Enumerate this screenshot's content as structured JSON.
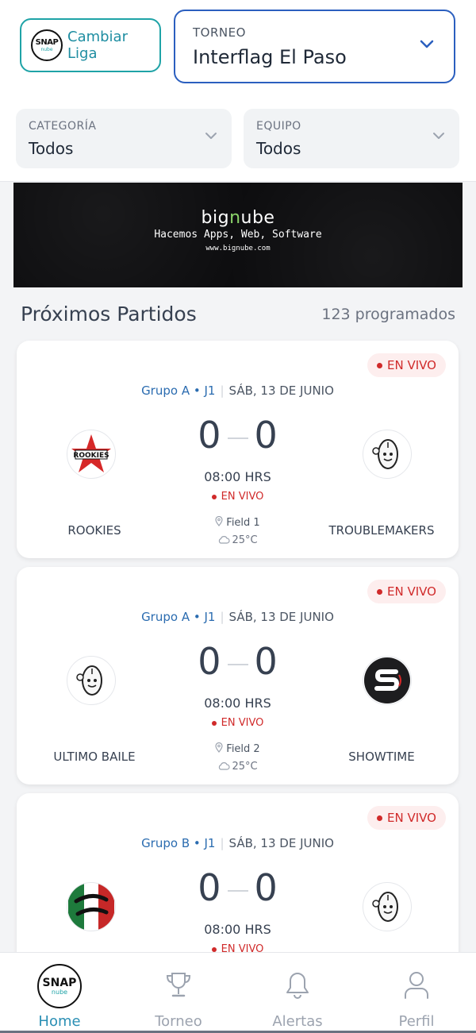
{
  "header": {
    "change_league_label": "Cambiar Liga",
    "logo_text": "SNAP",
    "logo_sub": "nube",
    "tournament_label": "TORNEO",
    "tournament_value": "Interflag El Paso"
  },
  "filters": {
    "category_label": "CATEGORÍA",
    "category_value": "Todos",
    "team_label": "EQUIPO",
    "team_value": "Todos"
  },
  "banner": {
    "brand_pre": "big",
    "brand_mid": "n",
    "brand_post": "ube",
    "tagline": "Hacemos Apps, Web, Software",
    "url": "www.bignube.com"
  },
  "section": {
    "title": "Próximos Partidos",
    "count": "123 programados"
  },
  "matches": [
    {
      "live_label": "EN VIVO",
      "group": "Grupo A • J1",
      "date": "SÁB, 13 DE JUNIO",
      "home_team": "ROOKIES",
      "away_team": "TROUBLEMAKERS",
      "home_score": "0",
      "away_score": "0",
      "time": "08:00 HRS",
      "status": "EN VIVO",
      "field": "Field 1",
      "weather": "25°C",
      "home_logo": "rookies-star",
      "away_logo": "football-mascot"
    },
    {
      "live_label": "EN VIVO",
      "group": "Grupo A • J1",
      "date": "SÁB, 13 DE JUNIO",
      "home_team": "ULTIMO BAILE",
      "away_team": "SHOWTIME",
      "home_score": "0",
      "away_score": "0",
      "time": "08:00 HRS",
      "status": "EN VIVO",
      "field": "Field 2",
      "weather": "25°C",
      "home_logo": "football-mascot",
      "away_logo": "showtime-s"
    },
    {
      "live_label": "EN VIVO",
      "group": "Grupo B • J1",
      "date": "SÁB, 13 DE JUNIO",
      "home_score": "0",
      "away_score": "0",
      "time": "08:00 HRS",
      "status": "EN VIVO",
      "home_logo": "all-gina",
      "away_logo": "football-mascot"
    }
  ],
  "nav": {
    "home": "Home",
    "tournament": "Torneo",
    "alerts": "Alertas",
    "profile": "Perfil",
    "active": "home"
  },
  "colors": {
    "accent": "#2b5fbf",
    "teal": "#1fa3a7",
    "live": "#d02a2a"
  }
}
